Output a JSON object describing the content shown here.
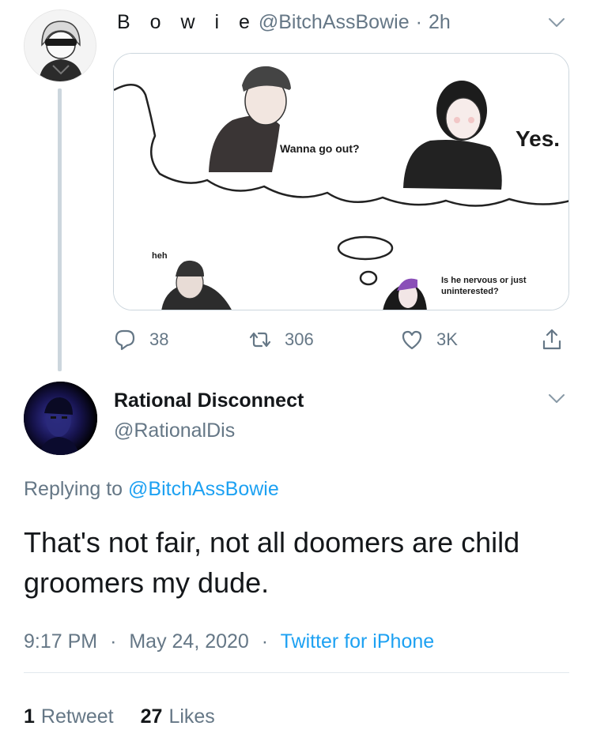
{
  "tweet1": {
    "display_name": "B o w i e",
    "handle": "@BitchAssBowie",
    "separator": "·",
    "time": "2h",
    "meme": {
      "caption_left": "Wanna go out?",
      "caption_right": "Yes.",
      "caption_heh": "heh",
      "caption_thought": "Is he nervous or just uninterested?"
    },
    "actions": {
      "replies": "38",
      "retweets": "306",
      "likes": "3K"
    }
  },
  "tweet2": {
    "display_name": "Rational Disconnect",
    "handle": "@RationalDis",
    "replying_prefix": "Replying to",
    "replying_to": "@BitchAssBowie",
    "text": "That's not fair, not all doomers are child groomers my dude.",
    "time": "9:17 PM",
    "date": "May 24, 2020",
    "source": "Twitter for iPhone",
    "meta_separator": "·",
    "retweet_count": "1",
    "retweet_label": "Retweet",
    "like_count": "27",
    "like_label": "Likes"
  },
  "colors": {
    "link": "#1da1f2",
    "secondary_text": "#657786",
    "primary_text": "#14171a",
    "thread_line": "#ccd6dd"
  },
  "icons": [
    "chevron-down-icon",
    "reply-icon",
    "retweet-icon",
    "like-icon",
    "share-icon"
  ]
}
